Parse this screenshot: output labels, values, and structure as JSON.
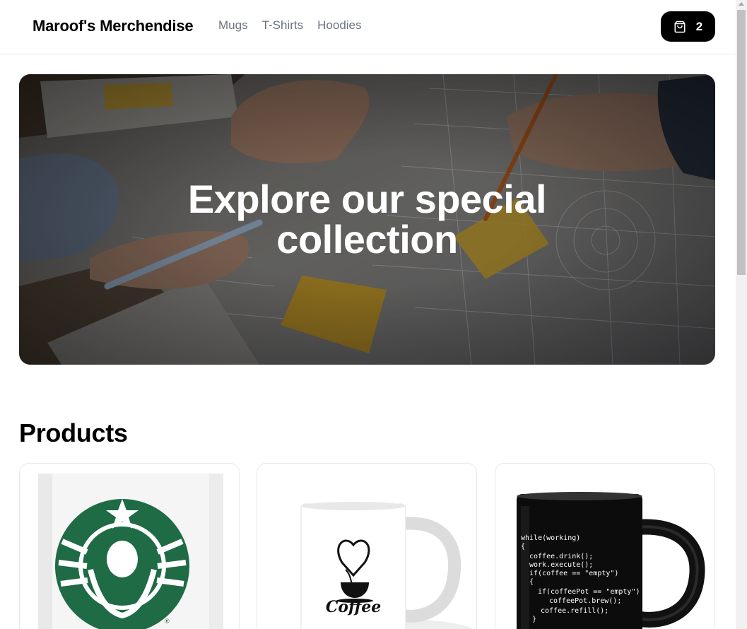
{
  "header": {
    "brand": "Maroof's Merchendise",
    "nav": [
      {
        "label": "Mugs"
      },
      {
        "label": "T-Shirts"
      },
      {
        "label": "Hoodies"
      }
    ],
    "cart": {
      "icon": "shopping-bag-icon",
      "count": "2"
    }
  },
  "hero": {
    "title_line1": "Explore our special",
    "title_line2": "collection"
  },
  "products": {
    "heading": "Products",
    "items": [
      {
        "image": "starbucks-mug-image"
      },
      {
        "image": "coffee-heart-mug-image",
        "print_text": "Coffee"
      },
      {
        "image": "code-coffee-mug-image",
        "print_lines": [
          "while(working)",
          "{",
          "coffee.drink();",
          "work.execute();",
          "if(coffee == \"empty\")",
          "{",
          "if(coffeePot == \"empty\")",
          "coffeePot.brew();",
          "coffee.refill();",
          "}"
        ]
      }
    ]
  },
  "colors": {
    "brand": "#000000",
    "nav_text": "#6b7280",
    "cart_bg": "#000000",
    "border": "#e5e7eb",
    "starbucks_green": "#1e6b45"
  }
}
